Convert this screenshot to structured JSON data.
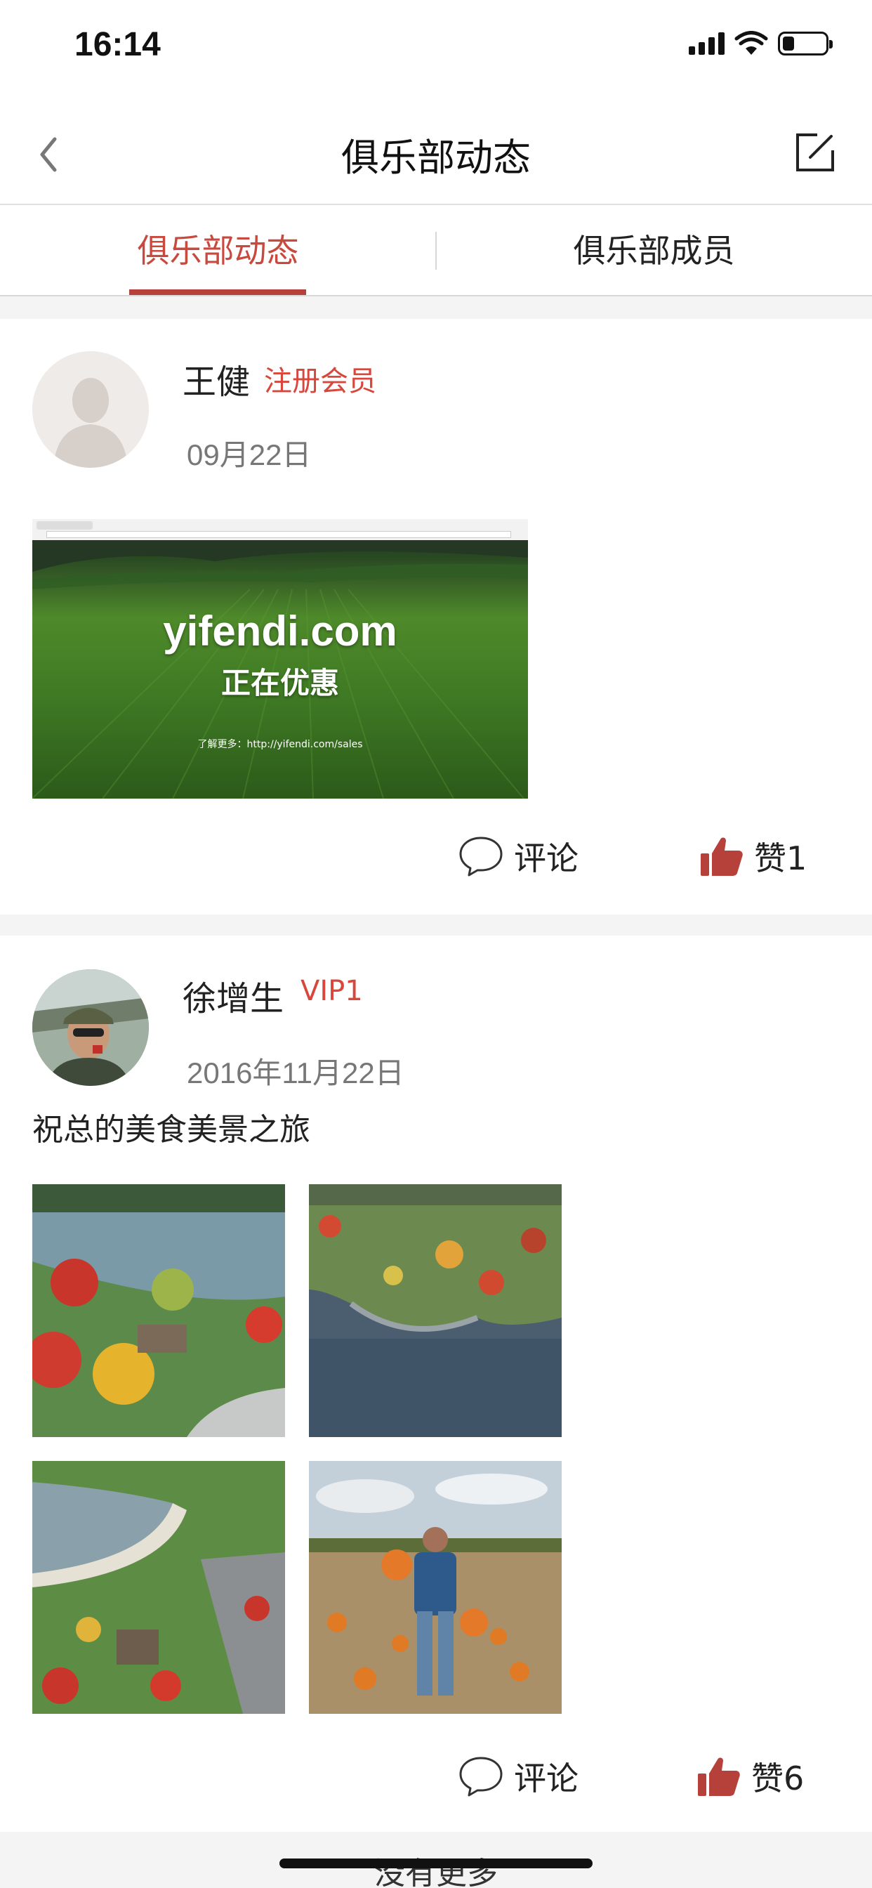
{
  "status_bar": {
    "time": "16:14"
  },
  "nav": {
    "title": "俱乐部动态"
  },
  "tabs": [
    {
      "label": "俱乐部动态",
      "active": true
    },
    {
      "label": "俱乐部成员",
      "active": false
    }
  ],
  "posts": [
    {
      "user": "王健",
      "badge": "注册会员",
      "date": "09月22日",
      "text": "",
      "banner": {
        "site": "yifendi.com",
        "headline": "正在优惠",
        "link": "了解更多：http://yifendi.com/sales"
      },
      "comment_label": "评论",
      "like_label": "赞1"
    },
    {
      "user": "徐增生",
      "badge": "VIP1",
      "date": "2016年11月22日",
      "text": "祝总的美食美景之旅",
      "comment_label": "评论",
      "like_label": "赞6"
    }
  ],
  "footer": {
    "text": "没有更多"
  },
  "colors": {
    "accent": "#c8493e",
    "like": "#b6413a"
  }
}
